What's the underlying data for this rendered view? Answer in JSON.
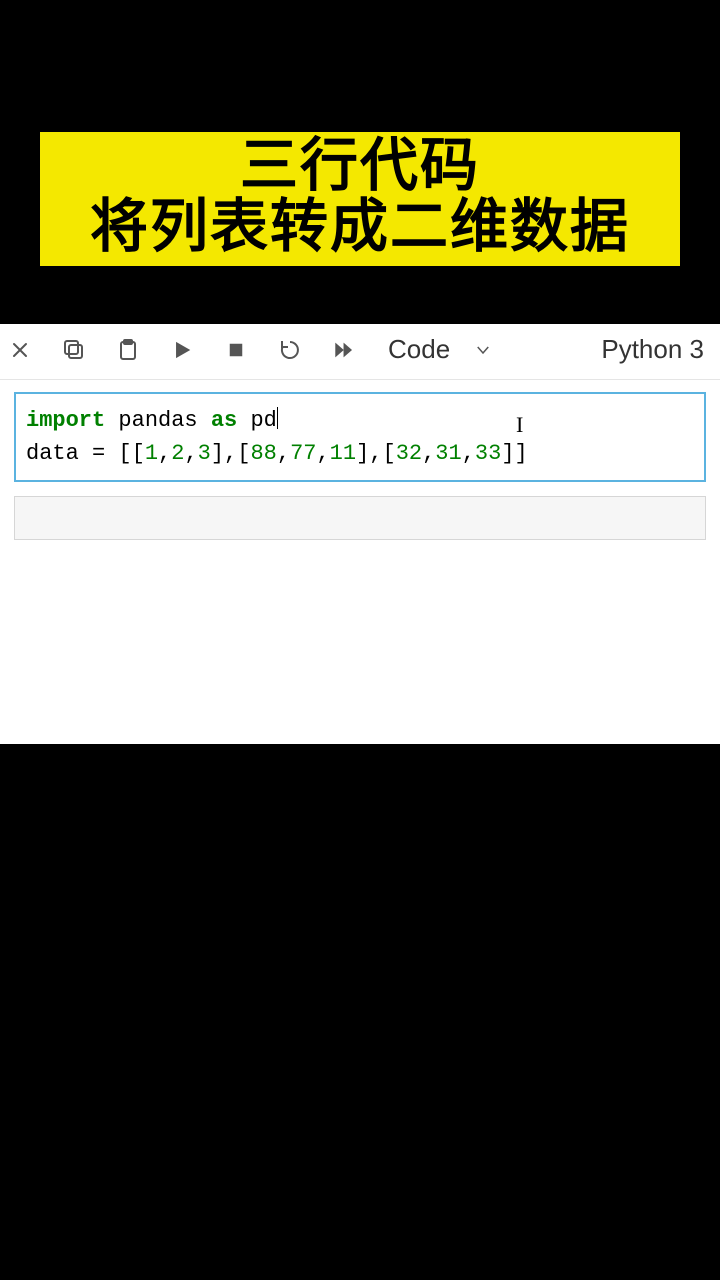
{
  "banner": {
    "line1": "三行代码",
    "line2": "将列表转成二维数据"
  },
  "toolbar": {
    "cellType": "Code",
    "kernel": "Python 3"
  },
  "code": {
    "kw_import": "import",
    "mod_pandas": " pandas ",
    "kw_as": "as",
    "mod_pd": " pd",
    "line2_pre": "data = [[",
    "n1": "1",
    "c": ",",
    "n2": "2",
    "n3": "3",
    "mid1": "],[",
    "n4": "88",
    "n5": "77",
    "n6": "11",
    "mid2": "],[",
    "n7": "32",
    "n8": "31",
    "n9": "33",
    "end": "]]"
  },
  "cursorGlyph": "I"
}
